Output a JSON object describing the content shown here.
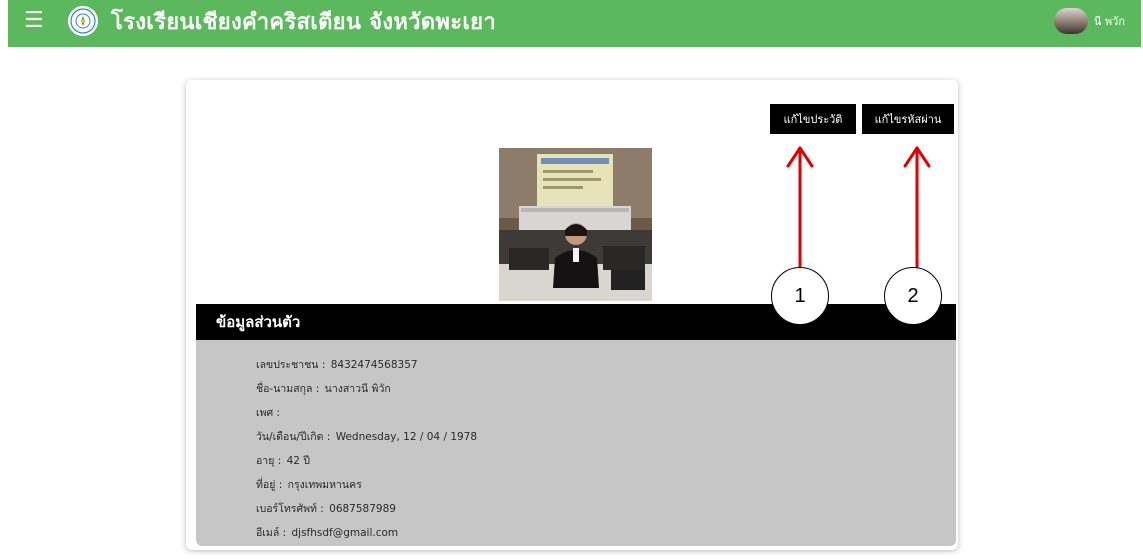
{
  "header": {
    "title": "โรงเรียนเชียงคำคริสเตียน จังหวัดพะเยา",
    "user_name": "นี พวัก",
    "bar_color": "#5cb85c"
  },
  "actions": {
    "edit_profile_label": "แก้ไขประวัติ",
    "change_password_label": "แก้ไขรหัสผ่าน"
  },
  "profile": {
    "section_title": "ข้อมูลส่วนตัว",
    "fields": [
      {
        "label": "เลขประชาชน",
        "value": "8432474568357"
      },
      {
        "label": "ชื่อ-นามสกุล",
        "value": "นางสาวนี พิวัก"
      },
      {
        "label": "เพศ",
        "value": ""
      },
      {
        "label": "วัน/เดือน/ปีเกิด",
        "value": "Wednesday, 12 / 04 / 1978"
      },
      {
        "label": "อายุ",
        "value": "42 ปี"
      },
      {
        "label": "ที่อยู่",
        "value": "กรุงเทพมหานคร"
      },
      {
        "label": "เบอร์โทรศัพท์",
        "value": "0687587989"
      },
      {
        "label": "อีเมล์",
        "value": "djsfhsdf@gmail.com"
      }
    ]
  },
  "annotations": {
    "callout_1": "1",
    "callout_2": "2",
    "arrow_color": "#e00000"
  },
  "icons": {
    "menu": "hamburger-icon",
    "logo": "school-seal-logo",
    "avatar": "user-avatar"
  }
}
